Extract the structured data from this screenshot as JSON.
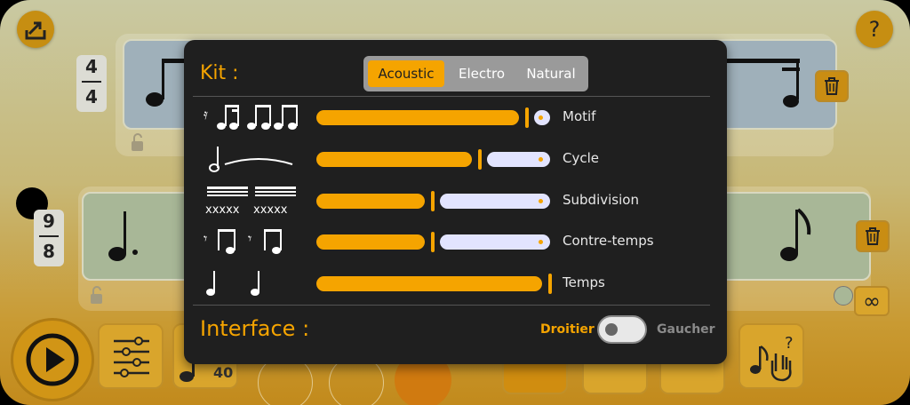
{
  "background": {
    "help_symbol": "?",
    "staves": [
      {
        "time_sig": {
          "numerator": "4",
          "denominator": "4"
        }
      },
      {
        "time_sig": {
          "numerator": "9",
          "denominator": "8"
        }
      }
    ],
    "loop_symbol": "∞",
    "tempo_value": "40"
  },
  "settings": {
    "kit_label": "Kit :",
    "kit_options": [
      "Acoustic",
      "Electro",
      "Natural"
    ],
    "kit_selected": "Acoustic",
    "rows": [
      {
        "label": "Motif",
        "level": 0.96
      },
      {
        "label": "Cycle",
        "level": 0.7
      },
      {
        "label": "Subdivision",
        "level": 0.49
      },
      {
        "label": "Contre-temps",
        "level": 0.49
      },
      {
        "label": "Temps",
        "level": 1.0
      }
    ],
    "interface_label": "Interface :",
    "hand_left_label": "Droitier",
    "hand_right_label": "Gaucher",
    "hand_toggle_on": false
  },
  "colors": {
    "accent": "#f5a400",
    "panel": "#1f1f1f",
    "slider_rest": "#e2e4ff"
  }
}
